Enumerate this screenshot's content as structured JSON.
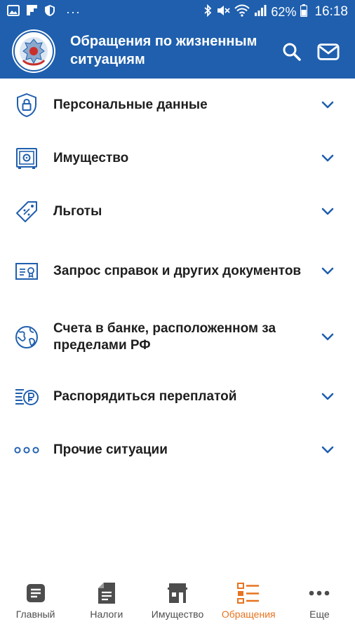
{
  "status_bar": {
    "battery": "62%",
    "time": "16:18",
    "more": "···"
  },
  "header": {
    "title": "Обращения по жизненным ситуациям"
  },
  "colors": {
    "primary": "#1f5fae",
    "accent": "#e8731e",
    "icon_blue": "#1f5fae",
    "nav_gray": "#4d4d4d"
  },
  "items": [
    {
      "label": "Персональные данные",
      "icon": "shield-lock-icon"
    },
    {
      "label": "Имущество",
      "icon": "safe-icon"
    },
    {
      "label": "Льготы",
      "icon": "discount-tag-icon"
    },
    {
      "label": "Запрос справок и других документов",
      "icon": "certificate-icon"
    },
    {
      "label": "Счета в банке, расположенном за пределами РФ",
      "icon": "globe-icon"
    },
    {
      "label": "Распорядиться переплатой",
      "icon": "ruble-coins-icon"
    },
    {
      "label": "Прочие ситуации",
      "icon": "three-dots-icon"
    }
  ],
  "nav": [
    {
      "label": "Главный",
      "icon": "document-icon",
      "active": false
    },
    {
      "label": "Налоги",
      "icon": "receipt-icon",
      "active": false
    },
    {
      "label": "Имущество",
      "icon": "building-icon",
      "active": false
    },
    {
      "label": "Обращения",
      "icon": "list-icon",
      "active": true
    },
    {
      "label": "Еще",
      "icon": "more-icon",
      "active": false
    }
  ]
}
